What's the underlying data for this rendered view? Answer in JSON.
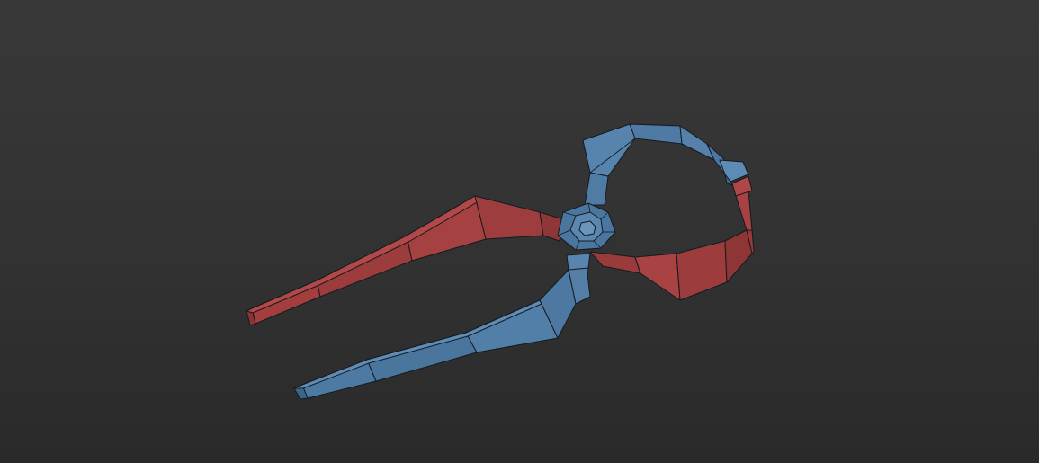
{
  "viewport": {
    "mode": "perspective",
    "shading": "shaded-with-edged-faces",
    "background_color_top": "#383838",
    "background_color_bottom": "#2a2a2a"
  },
  "model": {
    "object": "pliers-low-poly",
    "parts": [
      {
        "id": "handle-red",
        "color": "#9a3c3c"
      },
      {
        "id": "handle-blue",
        "color": "#4a76a0"
      },
      {
        "id": "pivot-joint",
        "color": "#4f7ca6"
      }
    ],
    "wire_color": "#151a20"
  }
}
